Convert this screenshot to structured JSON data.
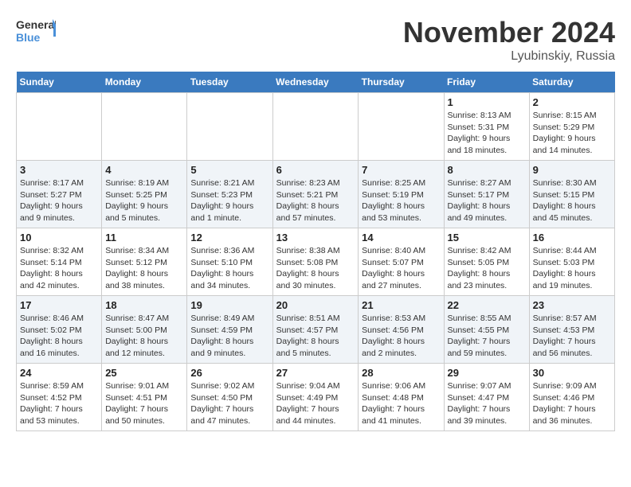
{
  "header": {
    "logo_line1": "General",
    "logo_line2": "Blue",
    "month": "November 2024",
    "location": "Lyubinskiy, Russia"
  },
  "weekdays": [
    "Sunday",
    "Monday",
    "Tuesday",
    "Wednesday",
    "Thursday",
    "Friday",
    "Saturday"
  ],
  "weeks": [
    [
      {
        "day": "",
        "info": ""
      },
      {
        "day": "",
        "info": ""
      },
      {
        "day": "",
        "info": ""
      },
      {
        "day": "",
        "info": ""
      },
      {
        "day": "",
        "info": ""
      },
      {
        "day": "1",
        "info": "Sunrise: 8:13 AM\nSunset: 5:31 PM\nDaylight: 9 hours and 18 minutes."
      },
      {
        "day": "2",
        "info": "Sunrise: 8:15 AM\nSunset: 5:29 PM\nDaylight: 9 hours and 14 minutes."
      }
    ],
    [
      {
        "day": "3",
        "info": "Sunrise: 8:17 AM\nSunset: 5:27 PM\nDaylight: 9 hours and 9 minutes."
      },
      {
        "day": "4",
        "info": "Sunrise: 8:19 AM\nSunset: 5:25 PM\nDaylight: 9 hours and 5 minutes."
      },
      {
        "day": "5",
        "info": "Sunrise: 8:21 AM\nSunset: 5:23 PM\nDaylight: 9 hours and 1 minute."
      },
      {
        "day": "6",
        "info": "Sunrise: 8:23 AM\nSunset: 5:21 PM\nDaylight: 8 hours and 57 minutes."
      },
      {
        "day": "7",
        "info": "Sunrise: 8:25 AM\nSunset: 5:19 PM\nDaylight: 8 hours and 53 minutes."
      },
      {
        "day": "8",
        "info": "Sunrise: 8:27 AM\nSunset: 5:17 PM\nDaylight: 8 hours and 49 minutes."
      },
      {
        "day": "9",
        "info": "Sunrise: 8:30 AM\nSunset: 5:15 PM\nDaylight: 8 hours and 45 minutes."
      }
    ],
    [
      {
        "day": "10",
        "info": "Sunrise: 8:32 AM\nSunset: 5:14 PM\nDaylight: 8 hours and 42 minutes."
      },
      {
        "day": "11",
        "info": "Sunrise: 8:34 AM\nSunset: 5:12 PM\nDaylight: 8 hours and 38 minutes."
      },
      {
        "day": "12",
        "info": "Sunrise: 8:36 AM\nSunset: 5:10 PM\nDaylight: 8 hours and 34 minutes."
      },
      {
        "day": "13",
        "info": "Sunrise: 8:38 AM\nSunset: 5:08 PM\nDaylight: 8 hours and 30 minutes."
      },
      {
        "day": "14",
        "info": "Sunrise: 8:40 AM\nSunset: 5:07 PM\nDaylight: 8 hours and 27 minutes."
      },
      {
        "day": "15",
        "info": "Sunrise: 8:42 AM\nSunset: 5:05 PM\nDaylight: 8 hours and 23 minutes."
      },
      {
        "day": "16",
        "info": "Sunrise: 8:44 AM\nSunset: 5:03 PM\nDaylight: 8 hours and 19 minutes."
      }
    ],
    [
      {
        "day": "17",
        "info": "Sunrise: 8:46 AM\nSunset: 5:02 PM\nDaylight: 8 hours and 16 minutes."
      },
      {
        "day": "18",
        "info": "Sunrise: 8:47 AM\nSunset: 5:00 PM\nDaylight: 8 hours and 12 minutes."
      },
      {
        "day": "19",
        "info": "Sunrise: 8:49 AM\nSunset: 4:59 PM\nDaylight: 8 hours and 9 minutes."
      },
      {
        "day": "20",
        "info": "Sunrise: 8:51 AM\nSunset: 4:57 PM\nDaylight: 8 hours and 5 minutes."
      },
      {
        "day": "21",
        "info": "Sunrise: 8:53 AM\nSunset: 4:56 PM\nDaylight: 8 hours and 2 minutes."
      },
      {
        "day": "22",
        "info": "Sunrise: 8:55 AM\nSunset: 4:55 PM\nDaylight: 7 hours and 59 minutes."
      },
      {
        "day": "23",
        "info": "Sunrise: 8:57 AM\nSunset: 4:53 PM\nDaylight: 7 hours and 56 minutes."
      }
    ],
    [
      {
        "day": "24",
        "info": "Sunrise: 8:59 AM\nSunset: 4:52 PM\nDaylight: 7 hours and 53 minutes."
      },
      {
        "day": "25",
        "info": "Sunrise: 9:01 AM\nSunset: 4:51 PM\nDaylight: 7 hours and 50 minutes."
      },
      {
        "day": "26",
        "info": "Sunrise: 9:02 AM\nSunset: 4:50 PM\nDaylight: 7 hours and 47 minutes."
      },
      {
        "day": "27",
        "info": "Sunrise: 9:04 AM\nSunset: 4:49 PM\nDaylight: 7 hours and 44 minutes."
      },
      {
        "day": "28",
        "info": "Sunrise: 9:06 AM\nSunset: 4:48 PM\nDaylight: 7 hours and 41 minutes."
      },
      {
        "day": "29",
        "info": "Sunrise: 9:07 AM\nSunset: 4:47 PM\nDaylight: 7 hours and 39 minutes."
      },
      {
        "day": "30",
        "info": "Sunrise: 9:09 AM\nSunset: 4:46 PM\nDaylight: 7 hours and 36 minutes."
      }
    ]
  ]
}
